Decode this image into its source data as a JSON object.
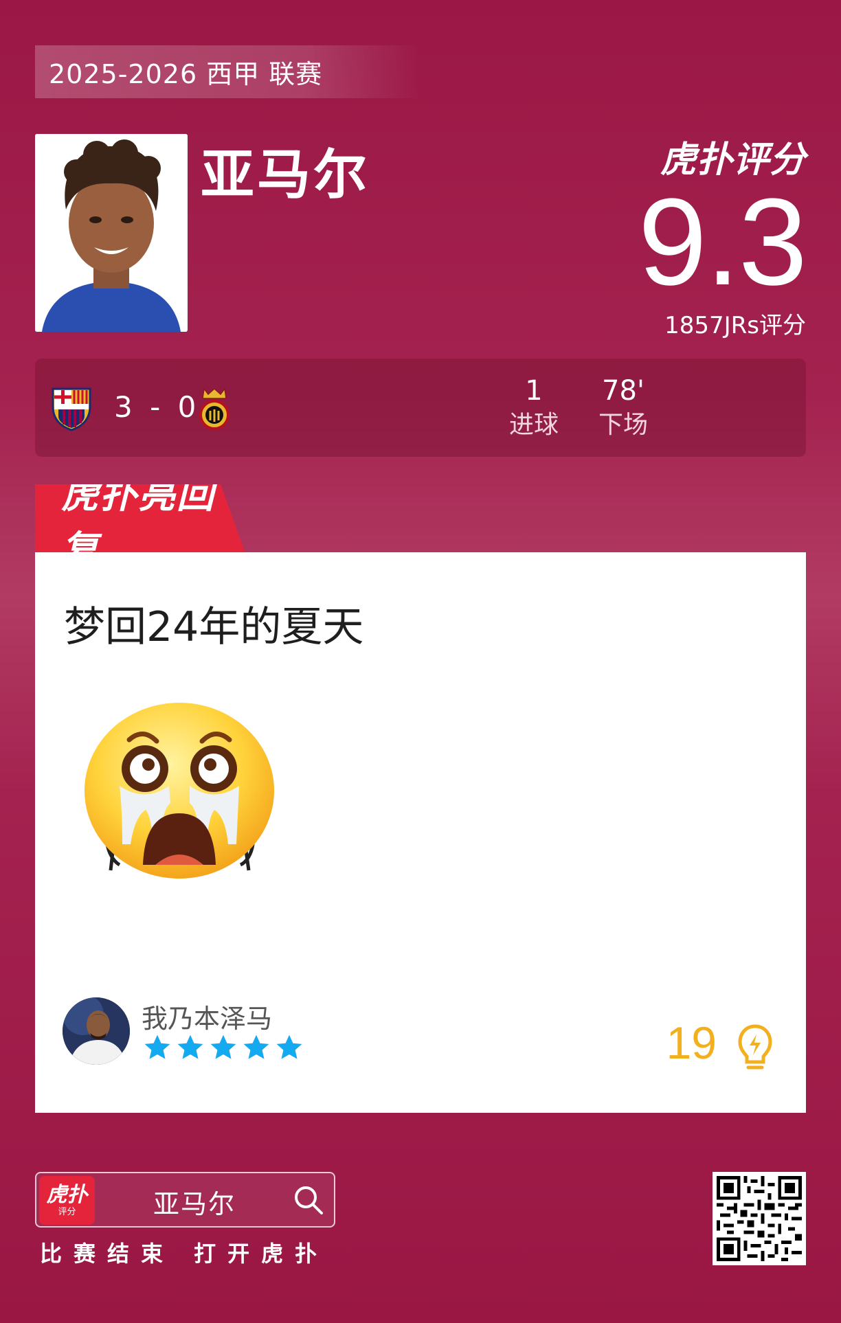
{
  "header": {
    "season": "2025-2026 西甲 联赛",
    "player_name": "亚马尔",
    "brand": "虎扑评分",
    "score": "9.3",
    "rating_count": "1857JRs评分"
  },
  "match": {
    "score": "3 - 0",
    "home_icon": "barcelona-crest-icon",
    "away_icon": "mallorca-crest-icon",
    "stats": [
      {
        "value": "1",
        "label": "进球"
      },
      {
        "value": "78'",
        "label": "下场"
      }
    ]
  },
  "reply": {
    "tab_label": "虎扑亮回复",
    "text": "梦回24年的夏天",
    "emoji": "crying-face-emoji",
    "username": "我乃本泽马",
    "stars": 5,
    "likes": "19",
    "colors": {
      "star": "#15a9f0",
      "likes": "#f2b01e"
    }
  },
  "footer": {
    "app_icon_top": "虎扑",
    "app_icon_bottom": "评分",
    "search_text": "亚马尔",
    "cta": "比赛结束 打开虎扑"
  }
}
